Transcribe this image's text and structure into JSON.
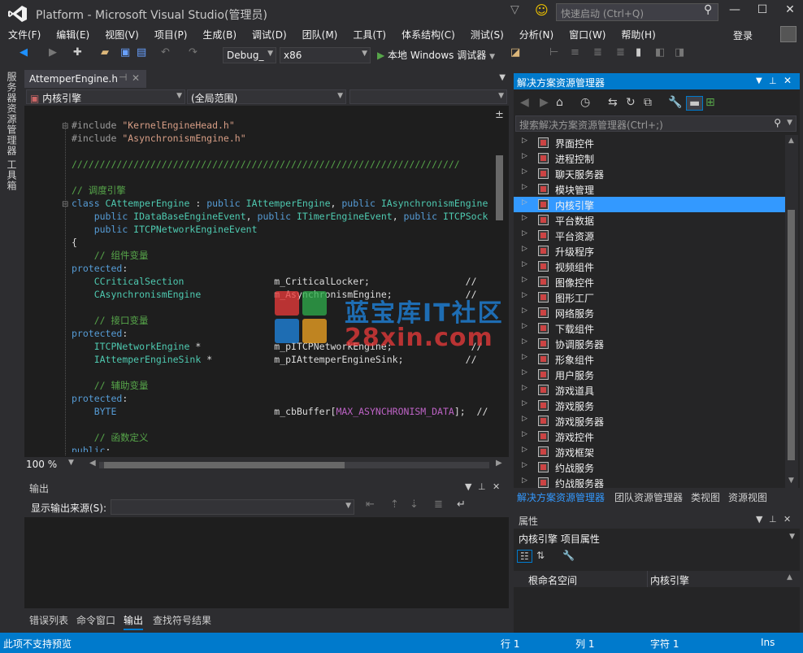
{
  "window": {
    "title": "Platform - Microsoft Visual Studio(管理员)",
    "quick_launch_placeholder": "快速启动 (Ctrl+Q)",
    "login": "登录"
  },
  "menu": [
    "文件(F)",
    "编辑(E)",
    "视图(V)",
    "项目(P)",
    "生成(B)",
    "调试(D)",
    "团队(M)",
    "工具(T)",
    "体系结构(C)",
    "测试(S)",
    "分析(N)",
    "窗口(W)",
    "帮助(H)"
  ],
  "toolbar": {
    "config": "Debug_",
    "platform": "x86",
    "run_label": "本地 Windows 调试器"
  },
  "left_strip": [
    "服务器资源管理器",
    "工具箱"
  ],
  "editor": {
    "tab": "AttemperEngine.h",
    "nav_left": "内核引擎",
    "nav_mid": "(全局范围)",
    "zoom": "100 %",
    "code": [
      [
        [
          "c-dir",
          "#include "
        ],
        [
          "c-str",
          "\"KernelEngineHead.h\""
        ]
      ],
      [
        [
          "c-dir",
          "#include "
        ],
        [
          "c-str",
          "\"AsynchronismEngine.h\""
        ]
      ],
      [
        [
          "c-txt",
          ""
        ]
      ],
      [
        [
          "c-com",
          "/////////////////////////////////////////////////////////////////////"
        ]
      ],
      [
        [
          "c-txt",
          ""
        ]
      ],
      [
        [
          "c-com",
          "// 调度引擎"
        ]
      ],
      [
        [
          "c-kw",
          "class "
        ],
        [
          "c-type",
          "CAttemperEngine"
        ],
        [
          "c-txt",
          " : "
        ],
        [
          "c-kw",
          "public "
        ],
        [
          "c-type",
          "IAttemperEngine"
        ],
        [
          "c-txt",
          ", "
        ],
        [
          "c-kw",
          "public "
        ],
        [
          "c-type",
          "IAsynchronismEngine"
        ]
      ],
      [
        [
          "c-txt",
          "    "
        ],
        [
          "c-kw",
          "public "
        ],
        [
          "c-type",
          "IDataBaseEngineEvent"
        ],
        [
          "c-txt",
          ", "
        ],
        [
          "c-kw",
          "public "
        ],
        [
          "c-type",
          "ITimerEngineEvent"
        ],
        [
          "c-txt",
          ", "
        ],
        [
          "c-kw",
          "public "
        ],
        [
          "c-type",
          "ITCPSock"
        ]
      ],
      [
        [
          "c-txt",
          "    "
        ],
        [
          "c-kw",
          "public "
        ],
        [
          "c-type",
          "ITCPNetworkEngineEvent"
        ]
      ],
      [
        [
          "c-txt",
          "{"
        ]
      ],
      [
        [
          "c-txt",
          "    "
        ],
        [
          "c-com",
          "// 组件变量"
        ]
      ],
      [
        [
          "c-kw",
          "protected"
        ],
        [
          "c-txt",
          ":"
        ]
      ],
      [
        [
          "c-txt",
          "    "
        ],
        [
          "c-type",
          "CCriticalSection"
        ],
        [
          "c-txt",
          "                m_CriticalLocker;                 //"
        ]
      ],
      [
        [
          "c-txt",
          "    "
        ],
        [
          "c-type",
          "CAsynchronismEngine"
        ],
        [
          "c-txt",
          "             m_AsynchronismEngine;             //"
        ]
      ],
      [
        [
          "c-txt",
          ""
        ]
      ],
      [
        [
          "c-txt",
          "    "
        ],
        [
          "c-com",
          "// 接口变量"
        ]
      ],
      [
        [
          "c-kw",
          "protected"
        ],
        [
          "c-txt",
          ":"
        ]
      ],
      [
        [
          "c-txt",
          "    "
        ],
        [
          "c-type",
          "ITCPNetworkEngine"
        ],
        [
          "c-txt",
          " *             m_pITCPNetworkEngine;              //"
        ]
      ],
      [
        [
          "c-txt",
          "    "
        ],
        [
          "c-type",
          "IAttemperEngineSink"
        ],
        [
          "c-txt",
          " *           m_pIAttemperEngineSink;           //"
        ]
      ],
      [
        [
          "c-txt",
          ""
        ]
      ],
      [
        [
          "c-txt",
          "    "
        ],
        [
          "c-com",
          "// 辅助变量"
        ]
      ],
      [
        [
          "c-kw",
          "protected"
        ],
        [
          "c-txt",
          ":"
        ]
      ],
      [
        [
          "c-txt",
          "    "
        ],
        [
          "c-kw",
          "BYTE"
        ],
        [
          "c-txt",
          "                            m_cbBuffer["
        ],
        [
          "c-mac",
          "MAX_ASYNCHRONISM_DATA"
        ],
        [
          "c-txt",
          "];  //"
        ]
      ],
      [
        [
          "c-txt",
          ""
        ]
      ],
      [
        [
          "c-txt",
          "    "
        ],
        [
          "c-com",
          "// 函数定义"
        ]
      ],
      [
        [
          "c-kw",
          "public"
        ],
        [
          "c-txt",
          ":"
        ]
      ]
    ]
  },
  "watermark": {
    "line1": "蓝宝库IT社区",
    "line2": "28xin.com"
  },
  "output": {
    "title": "输出",
    "source_label": "显示输出来源(S):"
  },
  "bottom_tabs": [
    "错误列表",
    "命令窗口",
    "输出",
    "查找符号结果"
  ],
  "solution_explorer": {
    "title": "解决方案资源管理器",
    "search_placeholder": "搜索解决方案资源管理器(Ctrl+;)",
    "items": [
      "界面控件",
      "进程控制",
      "聊天服务器",
      "模块管理",
      "内核引擎",
      "平台数据",
      "平台资源",
      "升级程序",
      "视频组件",
      "图像控件",
      "图形工厂",
      "网络服务",
      "下载组件",
      "协调服务器",
      "形象组件",
      "用户服务",
      "游戏道具",
      "游戏服务",
      "游戏服务器",
      "游戏控件",
      "游戏框架",
      "约战服务",
      "约战服务器"
    ],
    "selected_index": 4,
    "tabs": [
      "解决方案资源管理器",
      "团队资源管理器",
      "类视图",
      "资源视图"
    ]
  },
  "properties": {
    "title": "属性",
    "object": "内核引擎  项目属性",
    "row_name": "根命名空间",
    "row_value": "内核引擎"
  },
  "status": {
    "message": "此项不支持预览",
    "line": "行 1",
    "col": "列 1",
    "char": "字符 1",
    "mode": "Ins"
  }
}
